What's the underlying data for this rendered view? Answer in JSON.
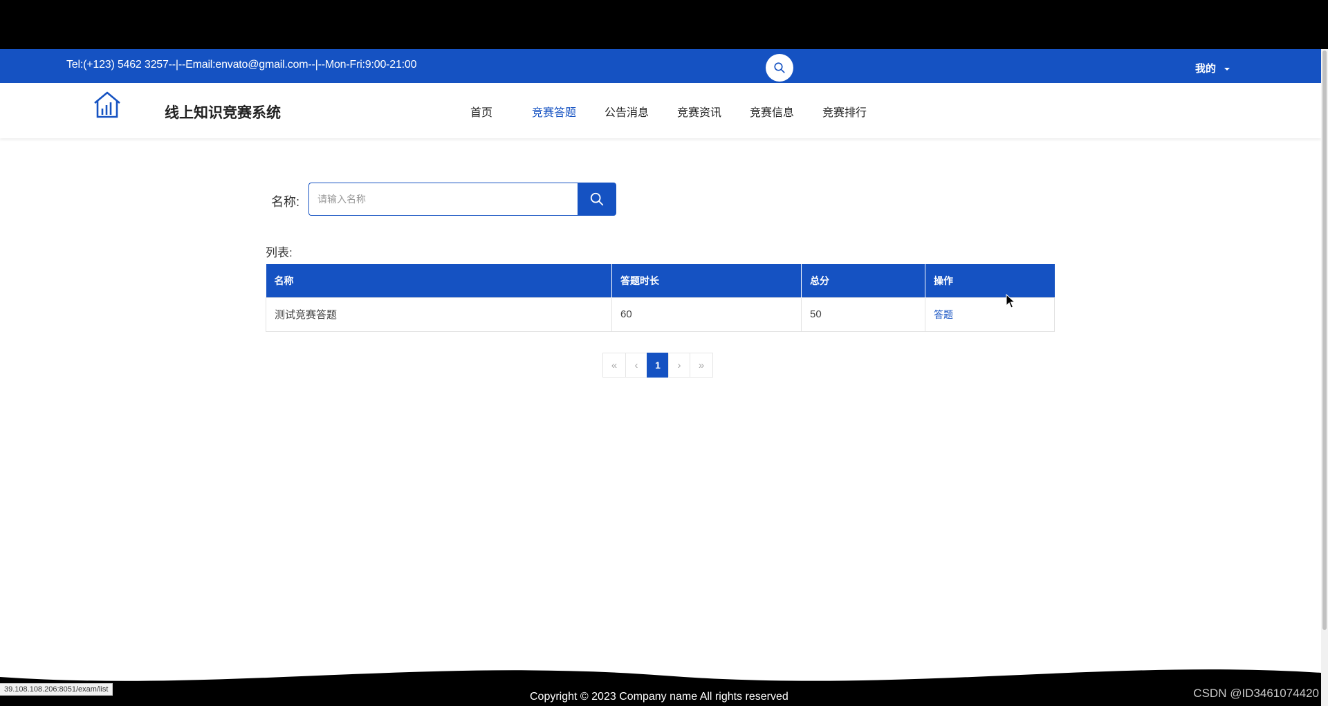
{
  "topbar": {
    "contact": "Tel:(+123) 5462 3257--|--Email:envato@gmail.com--|--Mon-Fri:9:00-21:00",
    "user_menu": "我的"
  },
  "navbar": {
    "site_title": "线上知识竞赛系统",
    "items": [
      {
        "label": "首页",
        "active": false
      },
      {
        "label": "竞赛答题",
        "active": true
      },
      {
        "label": "公告消息",
        "active": false
      },
      {
        "label": "竞赛资讯",
        "active": false
      },
      {
        "label": "竞赛信息",
        "active": false
      },
      {
        "label": "竞赛排行",
        "active": false
      }
    ]
  },
  "search": {
    "label": "名称:",
    "placeholder": "请输入名称",
    "value": ""
  },
  "list": {
    "label": "列表:",
    "columns": [
      "名称",
      "答题时长",
      "总分",
      "操作"
    ],
    "rows": [
      {
        "name": "测试竞赛答题",
        "duration": "60",
        "score": "50",
        "action": "答题"
      }
    ]
  },
  "pagination": {
    "first": "«",
    "prev": "‹",
    "current": "1",
    "next": "›",
    "last": "»"
  },
  "footer": {
    "copyright": "Copyright © 2023 Company name All rights reserved"
  },
  "status_bar": {
    "url": "39.108.108.206:8051/exam/list"
  },
  "watermark": "CSDN @ID3461074420",
  "colors": {
    "primary": "#1552c2",
    "background": "#ffffff",
    "footer": "#000000"
  }
}
